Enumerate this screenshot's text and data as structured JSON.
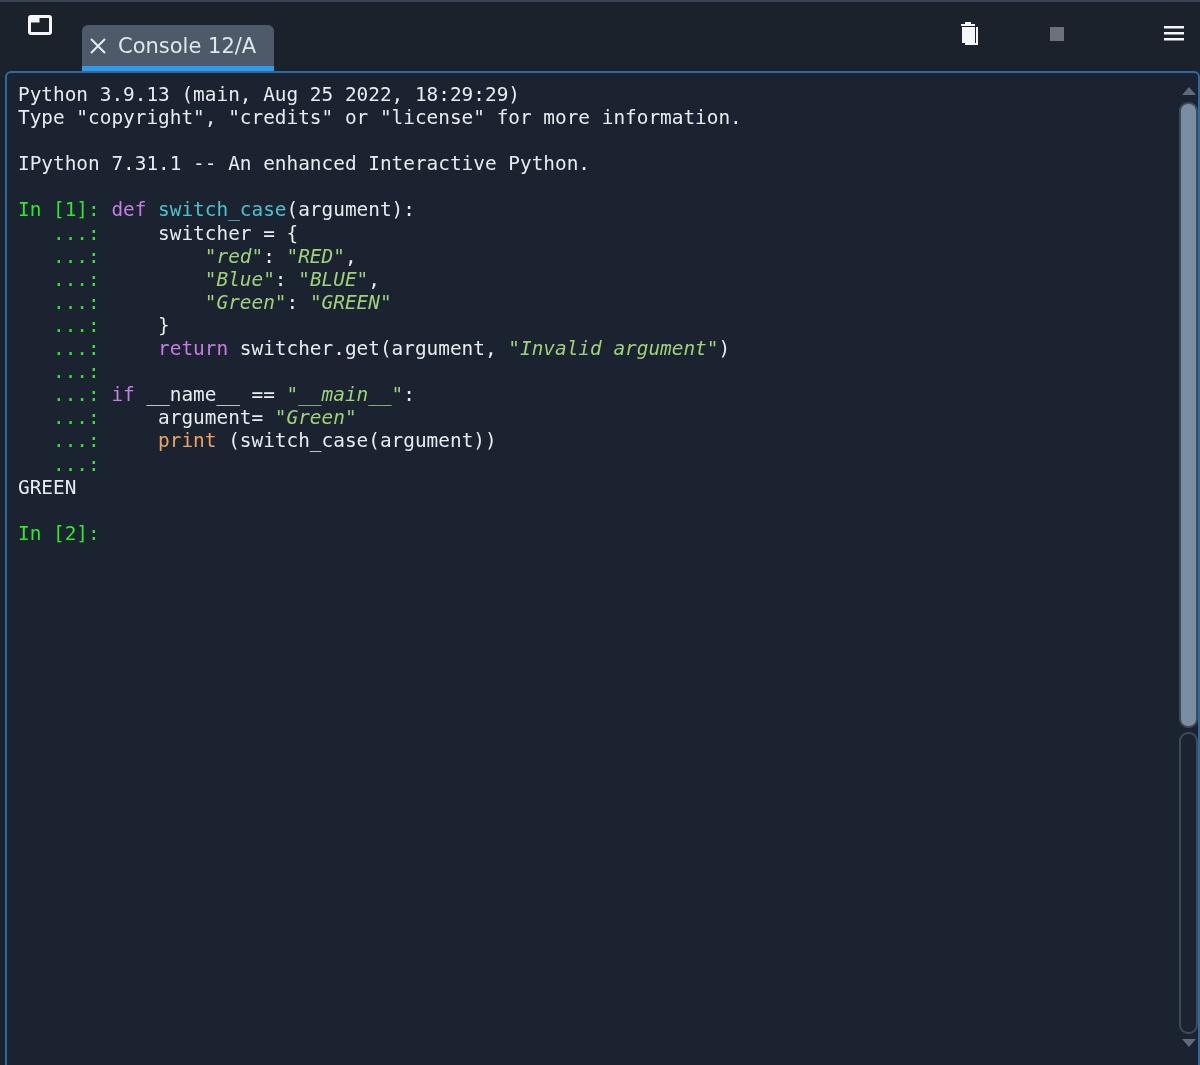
{
  "tabs": [
    {
      "label": "Console 12/A",
      "selected": true
    }
  ],
  "toolbar": [
    {
      "kind": "trash",
      "disabled": false
    },
    {
      "kind": "stop",
      "disabled": true
    },
    {
      "kind": "menu",
      "disabled": false
    }
  ],
  "console": {
    "lines": [
      {
        "kind": "output",
        "text": "Python 3.9.13 (main, Aug 25 2022, 18:29:29)"
      },
      {
        "kind": "output",
        "text": "Type \"copyright\", \"credits\" or \"license\" for more information."
      },
      {
        "kind": "blank"
      },
      {
        "kind": "output",
        "text": "IPython 7.31.1 -- An enhanced Interactive Python."
      },
      {
        "kind": "blank"
      },
      {
        "kind": "input",
        "prompt": "In [1]:",
        "segments": [
          {
            "kind": "keyword",
            "text": "def"
          },
          {
            "kind": "function",
            "text": " switch_case"
          },
          {
            "kind": "plain",
            "text": "(argument):"
          }
        ]
      },
      {
        "kind": "input",
        "prompt": "...:",
        "segments": [
          {
            "kind": "plain",
            "text": "    switcher = {"
          }
        ]
      },
      {
        "kind": "input",
        "prompt": "...:",
        "segments": [
          {
            "kind": "string",
            "text": "        \"red\""
          },
          {
            "kind": "plain",
            "text": ": "
          },
          {
            "kind": "string",
            "text": "\"RED\""
          },
          {
            "kind": "plain",
            "text": ","
          }
        ]
      },
      {
        "kind": "input",
        "prompt": "...:",
        "segments": [
          {
            "kind": "string",
            "text": "        \"Blue\""
          },
          {
            "kind": "plain",
            "text": ": "
          },
          {
            "kind": "string",
            "text": "\"BLUE\""
          },
          {
            "kind": "plain",
            "text": ","
          }
        ]
      },
      {
        "kind": "input",
        "prompt": "...:",
        "segments": [
          {
            "kind": "string",
            "text": "        \"Green\""
          },
          {
            "kind": "plain",
            "text": ": "
          },
          {
            "kind": "string",
            "text": "\"GREEN\""
          }
        ]
      },
      {
        "kind": "input",
        "prompt": "...:",
        "segments": [
          {
            "kind": "plain",
            "text": "    }"
          }
        ]
      },
      {
        "kind": "input",
        "prompt": "...:",
        "segments": [
          {
            "kind": "keyword",
            "text": "    return"
          },
          {
            "kind": "plain",
            "text": " switcher.get(argument, "
          },
          {
            "kind": "string",
            "text": "\"Invalid argument\""
          },
          {
            "kind": "plain",
            "text": ")"
          }
        ]
      },
      {
        "kind": "input",
        "prompt": "...:"
      },
      {
        "kind": "input",
        "prompt": "...:",
        "segments": [
          {
            "kind": "keyword",
            "text": "if"
          },
          {
            "kind": "plain",
            "text": " __name__ == "
          },
          {
            "kind": "string",
            "text": "\"__main__\""
          },
          {
            "kind": "plain",
            "text": ":"
          }
        ]
      },
      {
        "kind": "input",
        "prompt": "...:",
        "segments": [
          {
            "kind": "plain",
            "text": "    argument= "
          },
          {
            "kind": "string",
            "text": "\"Green\""
          }
        ]
      },
      {
        "kind": "input",
        "prompt": "...:",
        "segments": [
          {
            "kind": "builtin",
            "text": "    print"
          },
          {
            "kind": "plain",
            "text": " (switch_case(argument))"
          }
        ]
      },
      {
        "kind": "input",
        "prompt": "...:"
      },
      {
        "kind": "output",
        "text": "GREEN"
      },
      {
        "kind": "blank"
      },
      {
        "kind": "input",
        "prompt": "In [2]:"
      }
    ]
  }
}
